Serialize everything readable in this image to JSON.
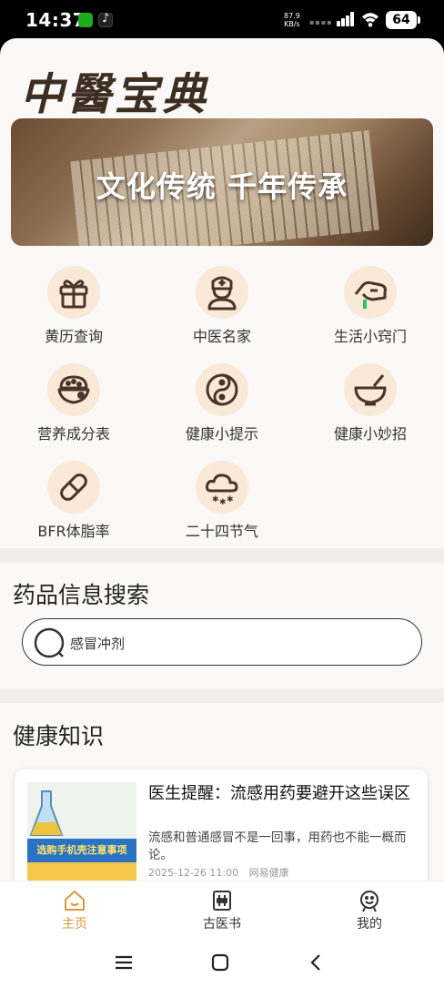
{
  "status_bar": {
    "time": "14:37",
    "net_speed_value": "87.9",
    "net_speed_unit": "KB/s",
    "battery": "64"
  },
  "app": {
    "logo_text": "中醫宝典"
  },
  "banner": {
    "title": "文化传统 千年传承"
  },
  "grid": {
    "items": [
      {
        "label": "黄历查询",
        "icon": "gift-icon"
      },
      {
        "label": "中医名家",
        "icon": "doctor-icon"
      },
      {
        "label": "生活小窍门",
        "icon": "hand-icon"
      },
      {
        "label": "营养成分表",
        "icon": "bowl-icon"
      },
      {
        "label": "健康小提示",
        "icon": "yin-yang-icon"
      },
      {
        "label": "健康小妙招",
        "icon": "mortar-icon"
      },
      {
        "label": "BFR体脂率",
        "icon": "pill-icon"
      },
      {
        "label": "二十四节气",
        "icon": "snow-cloud-icon"
      }
    ]
  },
  "search": {
    "title": "药品信息搜索",
    "value": "感冒冲剂"
  },
  "knowledge": {
    "title": "健康知识",
    "articles": [
      {
        "title": "医生提醒：流感用药要避开这些误区",
        "summary": "流感和普通感冒不是一回事，用药也不能一概而论。",
        "date": "2025-12-26 11:00",
        "source": "网易健康",
        "thumb_banner": "选购手机壳注意事项"
      }
    ]
  },
  "tabs": [
    {
      "label": "主页",
      "active": true
    },
    {
      "label": "古医书",
      "active": false
    },
    {
      "label": "我的",
      "active": false
    }
  ],
  "colors": {
    "accent": "#d89a3b",
    "icon_bg": "#fbe9d8",
    "icon_stroke": "#4a3528"
  }
}
